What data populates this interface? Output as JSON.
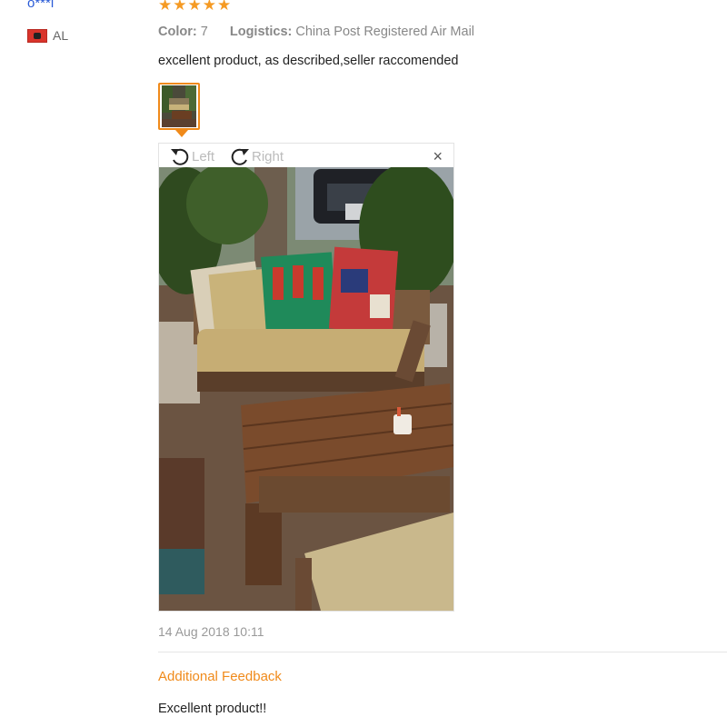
{
  "reviewer": {
    "name": "o***i",
    "country_code": "AL"
  },
  "review": {
    "rating_stars": 5,
    "color_label": "Color:",
    "color_value": "7",
    "logistics_label": "Logistics:",
    "logistics_value": "China Post Registered Air Mail",
    "text": "excellent product, as described,seller raccomended",
    "date": "14 Aug 2018 10:11"
  },
  "viewer": {
    "rotate_left_label": "Left",
    "rotate_right_label": "Right",
    "close_symbol": "×"
  },
  "additional_feedback": {
    "title": "Additional Feedback",
    "text": "Excellent product!!"
  },
  "colors": {
    "accent": "#f08a1a",
    "star": "#f59a23",
    "link": "#2a5bd7"
  },
  "icons": [
    "star-icon",
    "flag-icon",
    "rotate-left-icon",
    "rotate-right-icon",
    "close-icon"
  ]
}
